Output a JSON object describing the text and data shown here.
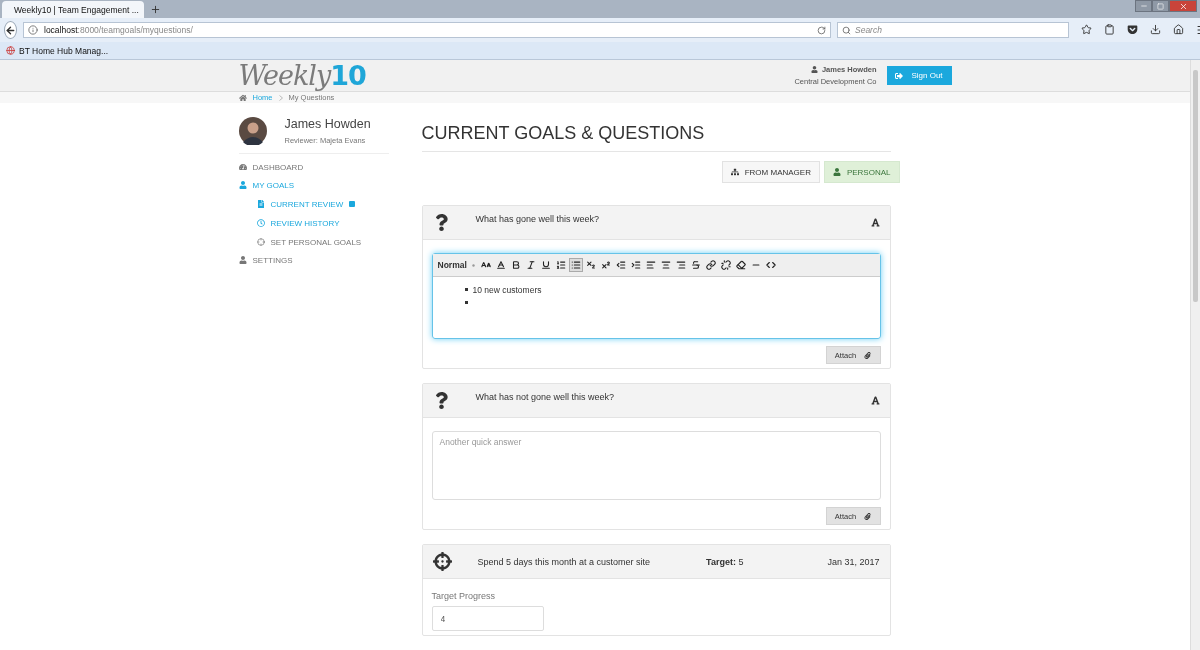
{
  "browser": {
    "tab_title": "Weekly10 | Team Engagement ...",
    "url_host": "localhost",
    "url_path": ":8000/teamgoals/myquestions/",
    "search_placeholder": "Search",
    "bookmark": "BT Home Hub Manag..."
  },
  "header": {
    "logo": {
      "text": "Weekly",
      "accent": "10"
    },
    "user_name": "James Howden",
    "company": "Central Development Co",
    "sign_out": "Sign Out"
  },
  "breadcrumb": [
    "Home",
    "My Questions"
  ],
  "profile": {
    "name": "James Howden",
    "reviewer": "Reviewer: Majeta Evans"
  },
  "nav": [
    {
      "label": "DASHBOARD",
      "kind": "dashboard",
      "highlighted": false,
      "selected": false
    },
    {
      "label": "MY GOALS",
      "kind": "user",
      "highlighted": true,
      "selected": false,
      "children": [
        {
          "label": "CURRENT REVIEW",
          "kind": "file",
          "highlighted": true,
          "selected": true
        },
        {
          "label": "REVIEW HISTORY",
          "kind": "history",
          "highlighted": true,
          "selected": false
        },
        {
          "label": "SET PERSONAL GOALS",
          "kind": "target",
          "highlighted": false,
          "selected": false
        }
      ]
    },
    {
      "label": "SETTINGS",
      "kind": "user",
      "highlighted": false,
      "selected": false
    }
  ],
  "page_title": "CURRENT GOALS & QUESTIONS",
  "filters": [
    {
      "label": "FROM MANAGER",
      "kind": "sitemap",
      "selected": false
    },
    {
      "label": "PERSONAL",
      "kind": "user",
      "selected": true
    }
  ],
  "cards": [
    {
      "kind": "question",
      "question": "What has gone well this week?",
      "editor": {
        "kind": "rich",
        "focused": true,
        "format": "Normal",
        "toolbar": [
          {
            "kind": "size",
            "selected": false
          },
          {
            "kind": "color",
            "selected": false
          },
          {
            "kind": "bold",
            "selected": false
          },
          {
            "kind": "italic",
            "selected": false
          },
          {
            "kind": "underline",
            "selected": false
          },
          {
            "kind": "ordered",
            "selected": false
          },
          {
            "kind": "bullets",
            "selected": true
          },
          {
            "kind": "subscript",
            "selected": false
          },
          {
            "kind": "superscript",
            "selected": false
          },
          {
            "kind": "outdent",
            "selected": false
          },
          {
            "kind": "indent",
            "selected": false
          },
          {
            "kind": "left",
            "selected": false
          },
          {
            "kind": "center",
            "selected": false
          },
          {
            "kind": "right",
            "selected": false
          },
          {
            "kind": "strike",
            "selected": false
          },
          {
            "kind": "link",
            "selected": false
          },
          {
            "kind": "unlink",
            "selected": false
          },
          {
            "kind": "eraser",
            "selected": false
          },
          {
            "kind": "rule",
            "selected": false
          },
          {
            "kind": "code",
            "selected": false
          }
        ],
        "items": [
          "10 new customers"
        ],
        "trailing_empty_item": true
      },
      "attach": "Attach"
    },
    {
      "kind": "question",
      "question": "What has not gone well this week?",
      "editor": {
        "kind": "plain",
        "focused": false,
        "placeholder": "Another quick answer"
      },
      "attach": "Attach"
    },
    {
      "kind": "goal",
      "title": "Spend 5 days this month at a customer site",
      "target": "**Target:** 5",
      "date": "Jan 31, 2017",
      "progress_label": "Target Progress",
      "progress_value": "4"
    }
  ]
}
